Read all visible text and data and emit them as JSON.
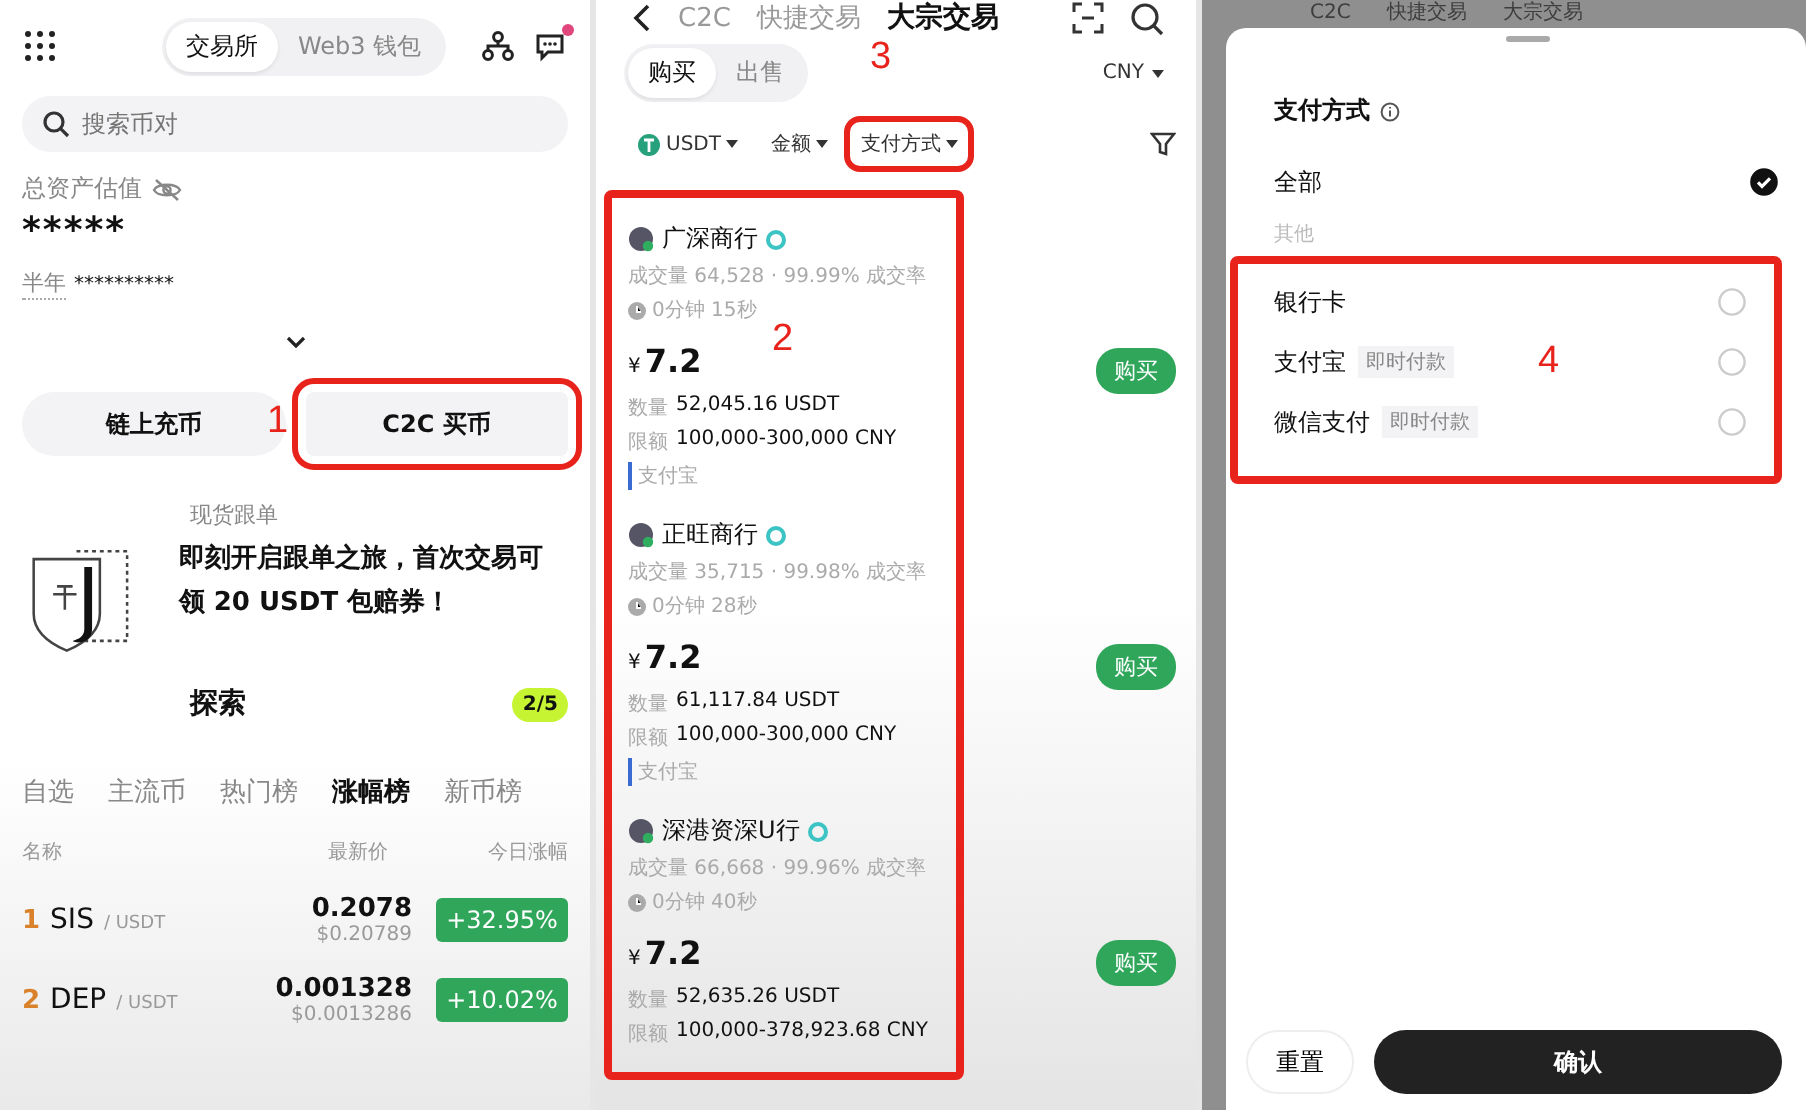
{
  "home": {
    "mode_tabs": [
      {
        "label": "交易所",
        "selected": true
      },
      {
        "label": "Web3 钱包",
        "selected": false
      }
    ],
    "has_notification": true,
    "search": {
      "placeholder": "搜索币对"
    },
    "assets": {
      "label": "总资产估值",
      "value": "*****",
      "period_label": "半年",
      "period_value": "**********"
    },
    "actions": [
      {
        "label": "链上充币"
      },
      {
        "label": "C2C 买币",
        "annotation": "1"
      }
    ],
    "promo": {
      "category": "现货跟单",
      "text": "即刻开启跟单之旅，首次交易可领 20 USDT 包赔券！",
      "link": "探索",
      "page": "2/5"
    },
    "market_tabs": [
      {
        "label": "自选",
        "selected": false
      },
      {
        "label": "主流币",
        "selected": false
      },
      {
        "label": "热门榜",
        "selected": false
      },
      {
        "label": "涨幅榜",
        "selected": true
      },
      {
        "label": "新币榜",
        "selected": false
      }
    ],
    "columns": [
      "名称",
      "最新价",
      "今日涨幅"
    ],
    "rows": [
      {
        "rank": "1",
        "base": "SIS",
        "quote": "/ USDT",
        "price": "0.2078",
        "usd": "$0.20789",
        "change": "+32.95%"
      },
      {
        "rank": "2",
        "base": "DEP",
        "quote": "/ USDT",
        "price": "0.001328",
        "usd": "$0.0013286",
        "change": "+10.02%"
      }
    ]
  },
  "c2c": {
    "nav": [
      {
        "label": "C2C",
        "selected": false
      },
      {
        "label": "快捷交易",
        "selected": false
      },
      {
        "label": "大宗交易",
        "selected": true
      }
    ],
    "side_tabs": [
      {
        "label": "购买",
        "selected": true
      },
      {
        "label": "出售",
        "selected": false
      }
    ],
    "currency": "CNY",
    "filters": [
      {
        "label": "USDT",
        "kind": "coin"
      },
      {
        "label": "金额",
        "kind": "plain"
      },
      {
        "label": "支付方式",
        "kind": "plain",
        "annotation": "3"
      }
    ],
    "offers_annotation": "2",
    "offers": [
      {
        "merchant": "广深商行",
        "stats": "成交量 64,528 · 99.99% 成交率",
        "time": "0分钟 15秒",
        "currency_symbol": "¥",
        "price": "7.2",
        "quantity_label": "数量",
        "quantity": "52,045.16 USDT",
        "limit_label": "限额",
        "limit": "100,000-300,000 CNY",
        "payment": "支付宝",
        "button": "购买"
      },
      {
        "merchant": "正旺商行",
        "stats": "成交量 35,715 · 99.98% 成交率",
        "time": "0分钟 28秒",
        "currency_symbol": "¥",
        "price": "7.2",
        "quantity_label": "数量",
        "quantity": "61,117.84 USDT",
        "limit_label": "限额",
        "limit": "100,000-300,000 CNY",
        "payment": "支付宝",
        "button": "购买"
      },
      {
        "merchant": "深港资深U行",
        "stats": "成交量 66,668 · 99.96% 成交率",
        "time": "0分钟 40秒",
        "currency_symbol": "¥",
        "price": "7.2",
        "quantity_label": "数量",
        "quantity": "52,635.26 USDT",
        "limit_label": "限额",
        "limit": "100,000-378,923.68 CNY",
        "button": "购买"
      }
    ]
  },
  "payment_sheet": {
    "background_nav": [
      "C2C",
      "快捷交易",
      "大宗交易"
    ],
    "title": "支付方式",
    "all_option": {
      "label": "全部",
      "checked": true
    },
    "section": "其他",
    "options_annotation": "4",
    "options": [
      {
        "label": "银行卡",
        "checked": false
      },
      {
        "label": "支付宝",
        "tag": "即时付款",
        "checked": false
      },
      {
        "label": "微信支付",
        "tag": "即时付款",
        "checked": false
      }
    ],
    "reset": "重置",
    "confirm": "确认"
  }
}
